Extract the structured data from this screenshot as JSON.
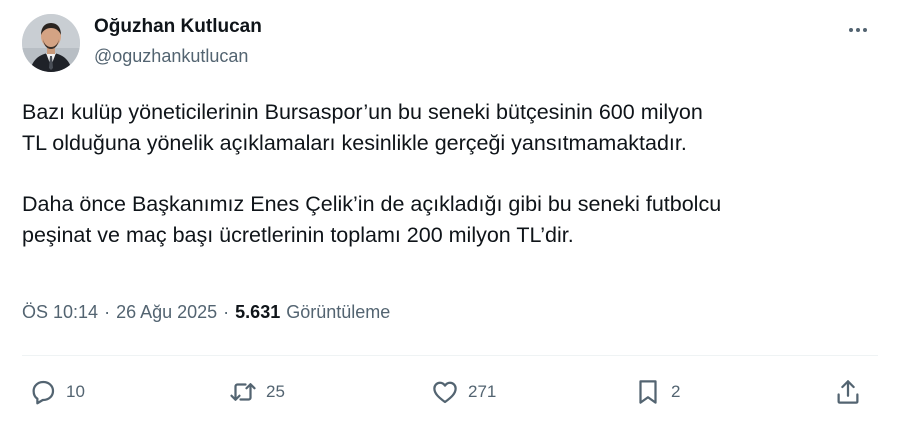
{
  "author": {
    "name": "Oğuzhan Kutlucan",
    "handle": "@oguzhankutlucan",
    "avatar_icon": "profile-photo"
  },
  "more_icon": "more-horizontal-icon",
  "tweet": {
    "paragraphs": [
      {
        "lines": [
          "Bazı kulüp yöneticilerinin Bursaspor’un bu seneki bütçesinin 600 milyon",
          "TL olduğuna yönelik açıklamaları kesinlikle gerçeği yansıtmamaktadır."
        ]
      },
      {
        "lines": [
          "Daha önce Başkanımız Enes Çelik’in de açıkladığı gibi bu seneki futbolcu",
          "peşinat ve maç başı ücretlerinin toplamı 200 milyon TL’dir."
        ]
      }
    ]
  },
  "meta": {
    "time": "ÖS 10:14",
    "separator": "·",
    "date": "26 Ağu 2025",
    "views_count": "5.631",
    "views_label": "Görüntüleme"
  },
  "actions": {
    "reply": {
      "icon": "reply-icon",
      "count": "10"
    },
    "retweet": {
      "icon": "retweet-icon",
      "count": "25"
    },
    "like": {
      "icon": "heart-icon",
      "count": "271"
    },
    "bookmark": {
      "icon": "bookmark-icon",
      "count": "2"
    },
    "share": {
      "icon": "share-icon"
    }
  },
  "colors": {
    "text_primary": "#0f1419",
    "text_secondary": "#536471",
    "divider": "#eff3f4"
  }
}
